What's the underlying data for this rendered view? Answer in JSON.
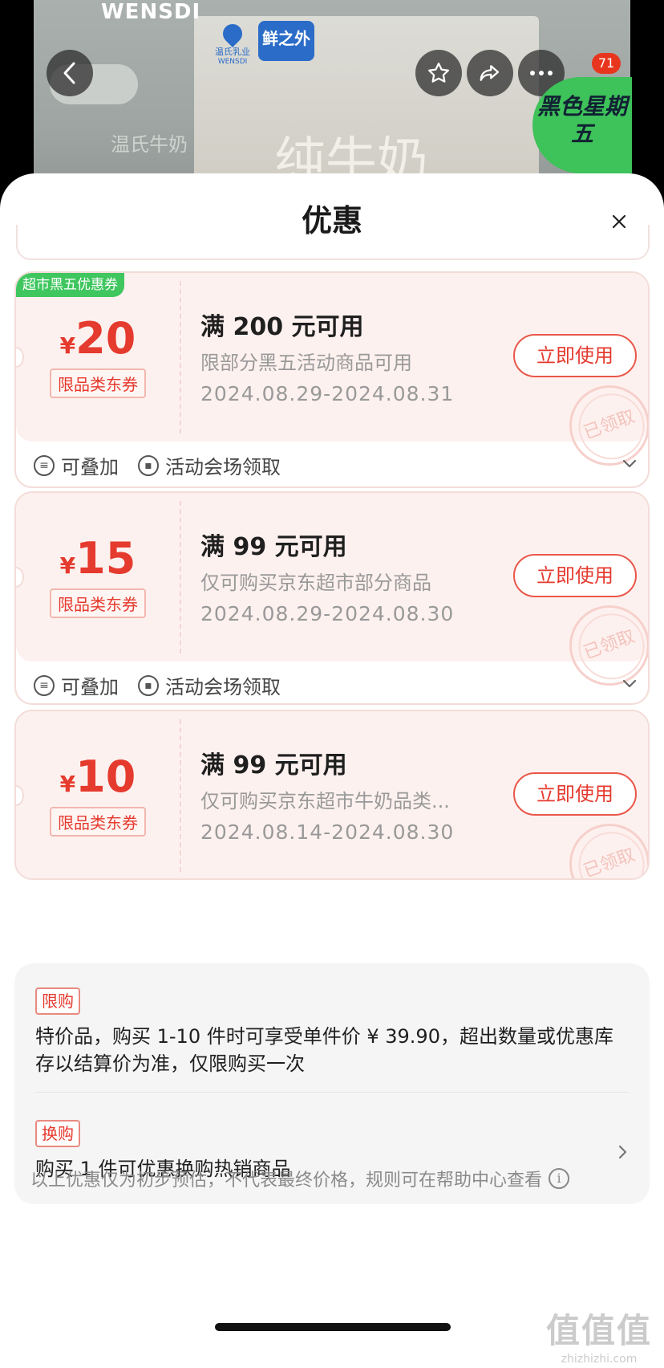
{
  "product_header": {
    "brand_left": "WENSDI",
    "brand_logo_text": "温氏乳业",
    "brand_logo_sub": "WENSDI",
    "brand_tag": "鲜之外",
    "product_char": "纯牛奶",
    "search_ghost": "温氏牛奶",
    "more_badge": "71",
    "promo_badge": "黑色星期五"
  },
  "sheet": {
    "title": "优惠"
  },
  "coupons": [
    {
      "corner_tag": "超市黑五优惠券",
      "currency": "¥",
      "amount": "20",
      "type": "限品类东券",
      "condition": "满 200 元可用",
      "description": "限部分黑五活动商品可用",
      "date": "2024.08.29-2024.08.31",
      "button": "立即使用",
      "stamp": "已领取",
      "stackable": "可叠加",
      "source": "活动会场领取"
    },
    {
      "corner_tag": "",
      "currency": "¥",
      "amount": "15",
      "type": "限品类东券",
      "condition": "满 99 元可用",
      "description": "仅可购买京东超市部分商品",
      "date": "2024.08.29-2024.08.30",
      "button": "立即使用",
      "stamp": "已领取",
      "stackable": "可叠加",
      "source": "活动会场领取"
    },
    {
      "corner_tag": "",
      "currency": "¥",
      "amount": "10",
      "type": "限品类东券",
      "condition": "满 99 元可用",
      "description": "仅可购买京东超市牛奶品类...",
      "date": "2024.08.14-2024.08.30",
      "button": "立即使用",
      "stamp": "已领取"
    }
  ],
  "info": {
    "limit_label": "限购",
    "limit_text": "特价品，购买 1-10 件时可享受单件价 ¥ 39.90，超出数量或优惠库存以结算价为准，仅限购买一次",
    "swap_label": "换购",
    "swap_text": "购买 1 件可优惠换购热销商品"
  },
  "footer": {
    "note": "以上优惠仅为初步预估，不代表最终价格，规则可在帮助中心查看"
  },
  "watermark": {
    "big": "值值值",
    "small": "zhizhizhi.com"
  },
  "colors": {
    "accent": "#e53a2e",
    "coupon_bg": "#fdf1ef",
    "corner_tag_green": "#3fc65e"
  }
}
